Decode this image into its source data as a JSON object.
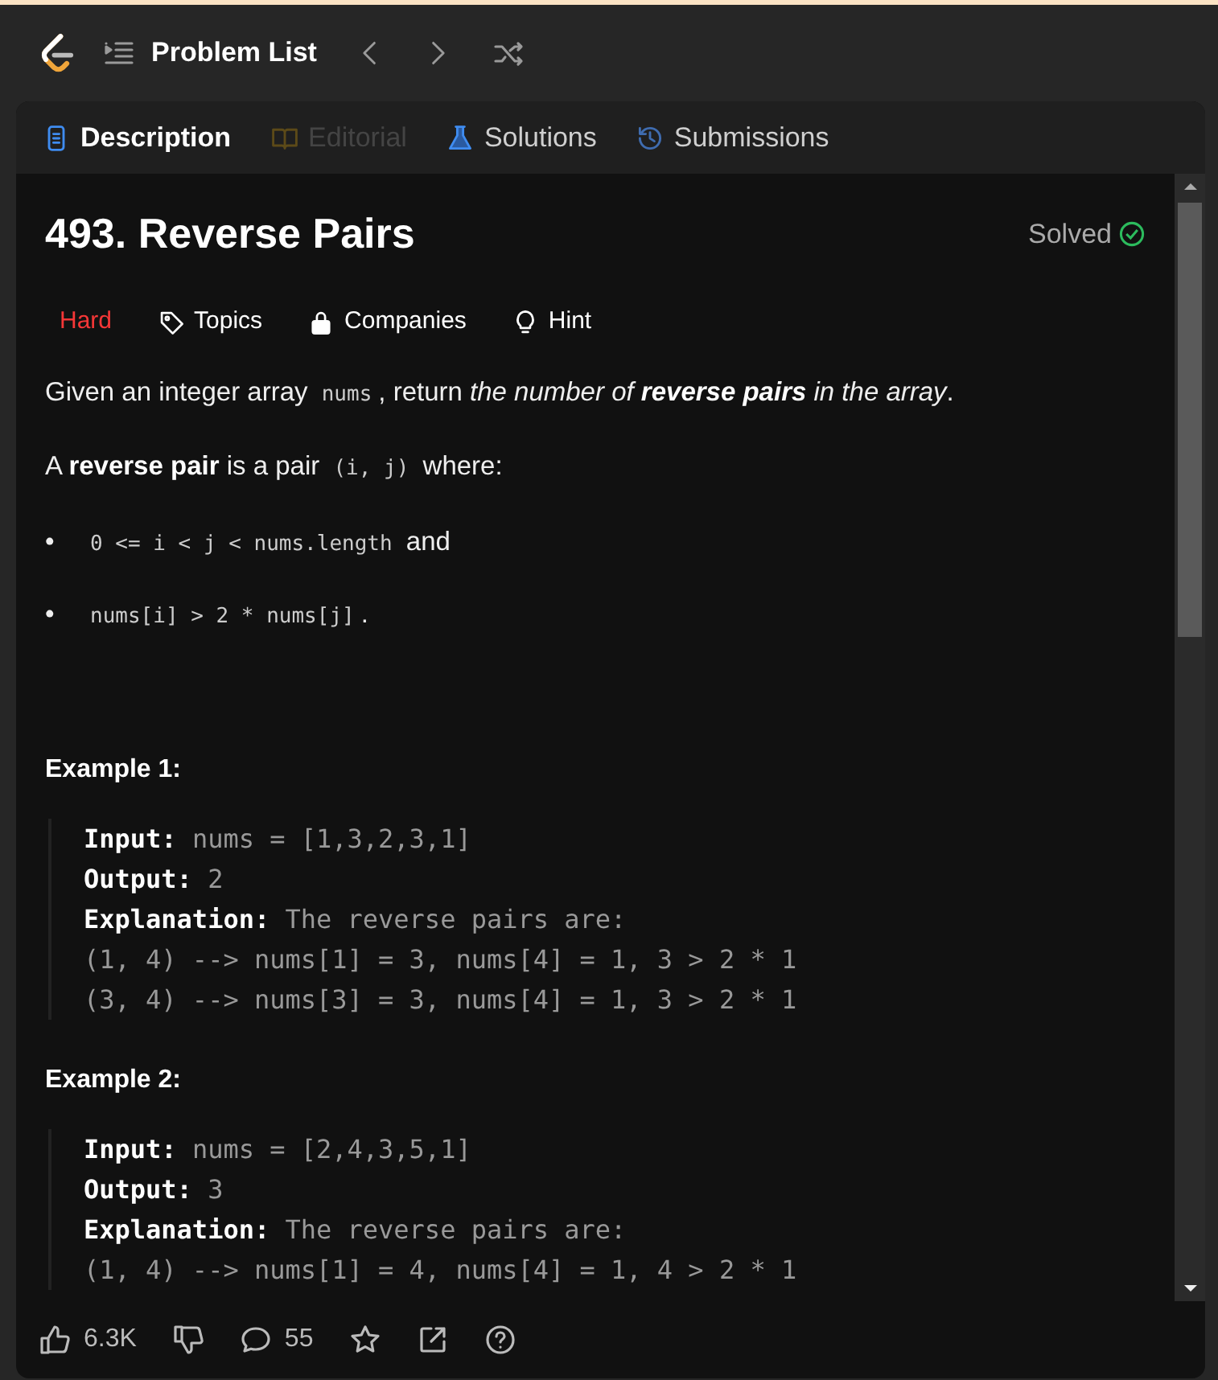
{
  "nav": {
    "title": "Problem List"
  },
  "tabs": [
    {
      "label": "Description",
      "kind": "description",
      "selected": true,
      "disabled": false
    },
    {
      "label": "Editorial",
      "kind": "editorial",
      "selected": false,
      "disabled": true
    },
    {
      "label": "Solutions",
      "kind": "solutions",
      "selected": false,
      "disabled": false
    },
    {
      "label": "Submissions",
      "kind": "submissions",
      "selected": false,
      "disabled": false
    }
  ],
  "problem": {
    "title": "493. Reverse Pairs",
    "status": "Solved"
  },
  "tags": [
    {
      "label": "Hard",
      "kind": "difficulty"
    },
    {
      "label": "Topics",
      "kind": "topics"
    },
    {
      "label": "Companies",
      "kind": "companies"
    },
    {
      "label": "Hint",
      "kind": "hint"
    }
  ],
  "paragraphs": [
    [
      {
        "kind": "plain",
        "text": "Given an integer array "
      },
      {
        "kind": "code",
        "text": "nums"
      },
      {
        "kind": "plain",
        "text": ", return "
      },
      {
        "kind": "italic",
        "text": "the number of "
      },
      {
        "kind": "bold-italic",
        "text": "reverse pairs"
      },
      {
        "kind": "italic",
        "text": " in the array"
      },
      {
        "kind": "plain",
        "text": "."
      }
    ],
    [
      {
        "kind": "plain",
        "text": "A "
      },
      {
        "kind": "bold",
        "text": "reverse pair"
      },
      {
        "kind": "plain",
        "text": " is a pair "
      },
      {
        "kind": "code",
        "text": "(i, j)"
      },
      {
        "kind": "plain",
        "text": " where:"
      }
    ]
  ],
  "bullets": [
    {
      "marker": "•",
      "parts": [
        {
          "kind": "code",
          "text": "0 <= i < j < nums.length"
        },
        {
          "kind": "plain",
          "text": " and"
        }
      ]
    },
    {
      "marker": "•",
      "parts": [
        {
          "kind": "code",
          "text": "nums[i] > 2 * nums[j]"
        },
        {
          "kind": "plain",
          "text": "."
        }
      ]
    }
  ],
  "examples": [
    {
      "title": "Example 1:",
      "lines": [
        {
          "label": "Input:",
          "text": "nums = [1,3,2,3,1]"
        },
        {
          "label": "Output:",
          "text": "2"
        },
        {
          "label": "Explanation:",
          "text": "The reverse pairs are:"
        },
        {
          "text": "(1, 4) --> nums[1] = 3, nums[4] = 1, 3 > 2 * 1"
        },
        {
          "text": "(3, 4) --> nums[3] = 3, nums[4] = 1, 3 > 2 * 1"
        }
      ]
    },
    {
      "title": "Example 2:",
      "lines": [
        {
          "label": "Input:",
          "text": "nums = [2,4,3,5,1]"
        },
        {
          "label": "Output:",
          "text": "3"
        },
        {
          "label": "Explanation:",
          "text": "The reverse pairs are:"
        },
        {
          "text": "(1, 4) --> nums[1] = 4, nums[4] = 1, 4 > 2 * 1"
        }
      ]
    }
  ],
  "footer": {
    "likes": "6.3K",
    "comments": "55"
  }
}
